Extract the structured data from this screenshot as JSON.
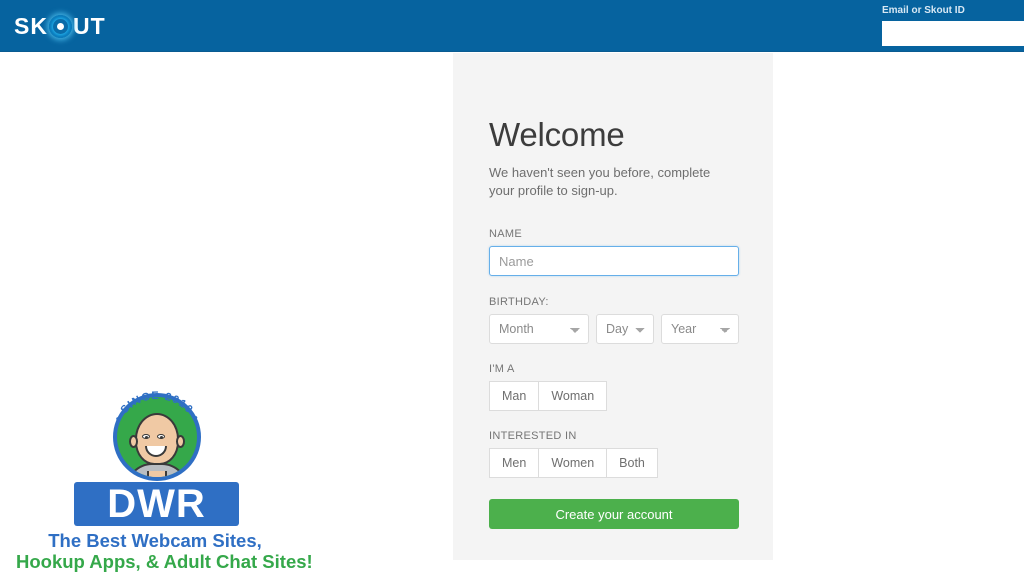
{
  "header": {
    "brand_part1": "SK",
    "brand_icon": "target-ring-icon",
    "brand_part2": "UT",
    "login_label": "Email or Skout ID",
    "login_value": "",
    "login_placeholder": ""
  },
  "signup": {
    "title": "Welcome",
    "subtitle": "We haven't seen you before, complete your profile to sign-up.",
    "name_label": "NAME",
    "name_value": "",
    "name_placeholder": "Name",
    "birthday_label": "BIRTHDAY:",
    "month_selected": "Month",
    "day_selected": "Day",
    "year_selected": "Year",
    "gender_label": "I'M A",
    "gender_options": [
      "Man",
      "Woman"
    ],
    "interest_label": "INTERESTED IN",
    "interest_options": [
      "Men",
      "Women",
      "Both"
    ],
    "submit_label": "Create your account"
  },
  "watermark": {
    "badge_arc": "• SINCE 2010 •",
    "word": "DWR",
    "tagline_line1": "The Best Webcam Sites,",
    "tagline_line2": "Hookup Apps, & Adult Chat Sites!"
  },
  "colors": {
    "header_blue": "#06639f",
    "accent_green": "#4cb04c",
    "focus_blue": "#66afe9",
    "card_gray": "#f4f4f4",
    "logo_blue": "#2f6fc4",
    "logo_green": "#35a84a"
  }
}
